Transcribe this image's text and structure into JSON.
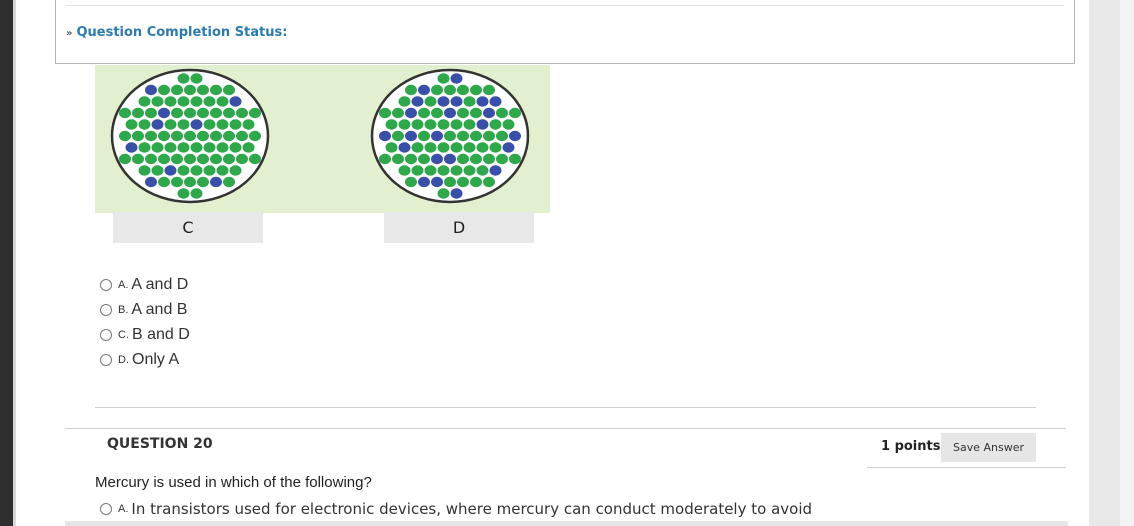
{
  "status": {
    "label": "Question Completion Status:"
  },
  "images": {
    "labels": [
      "C",
      "D"
    ],
    "colors": {
      "panel": "#e3f0cf",
      "green": "#2ea84a",
      "blue": "#3a4fa8",
      "ring": "#333333"
    }
  },
  "prev_question": {
    "options": [
      {
        "letter": "A.",
        "text": "A and D"
      },
      {
        "letter": "B.",
        "text": "A and B"
      },
      {
        "letter": "C.",
        "text": "B and D"
      },
      {
        "letter": "D.",
        "text": "Only A"
      }
    ]
  },
  "question": {
    "title": "QUESTION 20",
    "points": "1 points",
    "save_label": "Save Answer",
    "text": "Mercury is used in which of the following?",
    "options": [
      {
        "letter": "A.",
        "text": "In transistors used for electronic devices, where mercury can conduct moderately to avoid"
      }
    ]
  }
}
